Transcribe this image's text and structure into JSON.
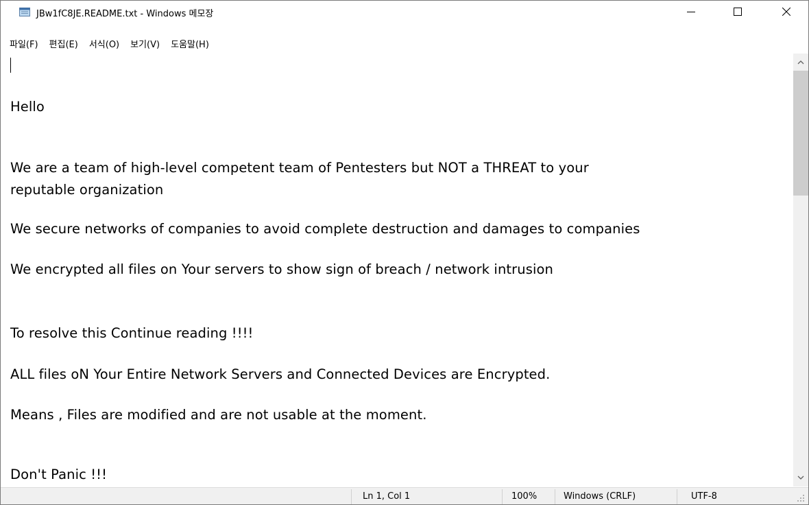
{
  "window": {
    "title": "JBw1fC8JE.README.txt - Windows 메모장"
  },
  "menu": {
    "items": [
      "파일(F)",
      "편집(E)",
      "서식(O)",
      "보기(V)",
      "도움말(H)"
    ]
  },
  "document": {
    "lines": [
      "Hello",
      "We are a team of high-level competent team of Pentesters but NOT a THREAT to your",
      "reputable organization",
      "We secure networks of companies to avoid complete destruction and damages to companies",
      "We encrypted all files on Your servers to show sign of breach / network intrusion",
      "To resolve this Continue reading !!!!",
      "ALL files oN Your Entire Network Servers and Connected Devices are Encrypted.",
      "Means , Files are modified and are not usable at the moment.",
      "Don't Panic !!!"
    ]
  },
  "status": {
    "position": "Ln 1, Col 1",
    "zoom": "100%",
    "line_ending": "Windows (CRLF)",
    "encoding": "UTF-8"
  },
  "icons": {
    "app": "notepad-icon",
    "minimize": "minimize-icon",
    "maximize": "maximize-icon",
    "close": "close-icon",
    "scroll_up": "chevron-up-icon",
    "scroll_down": "chevron-down-icon"
  },
  "colors": {
    "statusbar_bg": "#f0f0f0",
    "scrollbar_track": "#f0f0f0",
    "scrollbar_thumb": "#cdcdcd"
  }
}
